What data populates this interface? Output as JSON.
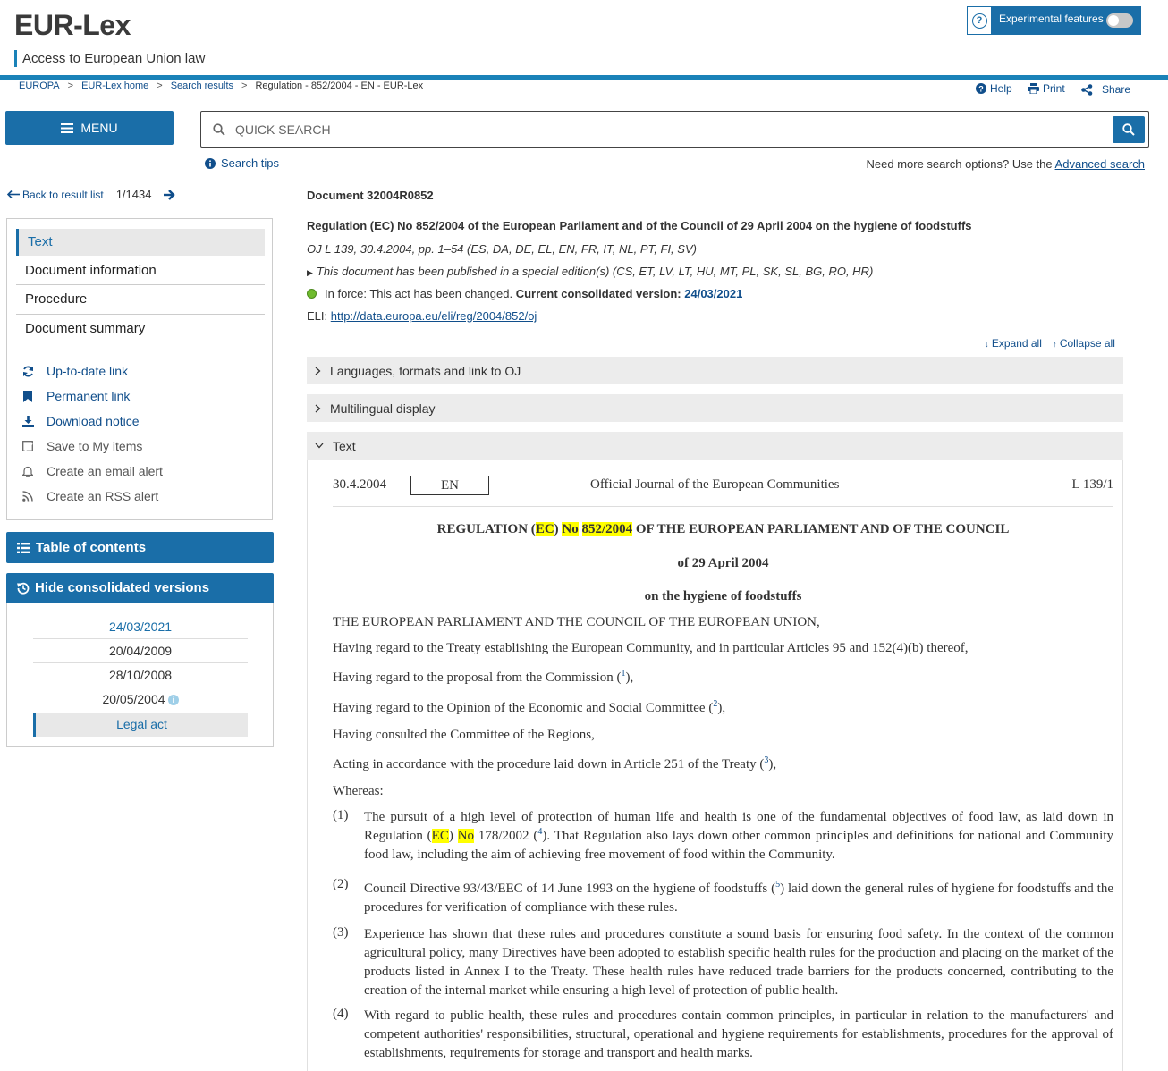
{
  "header": {
    "logo": "EUR-Lex",
    "tagline": "Access to European Union law",
    "experimental_label": "Experimental features"
  },
  "breadcrumb": [
    "EUROPA",
    "EUR-Lex home",
    "Search results",
    "Regulation - 852/2004 - EN - EUR-Lex"
  ],
  "tools": {
    "help": "Help",
    "print": "Print",
    "share": "Share"
  },
  "menu_label": "MENU",
  "search": {
    "placeholder": "QUICK SEARCH",
    "tips": "Search tips",
    "more_text": "Need more search options? Use the",
    "advanced": "Advanced search"
  },
  "nav": {
    "back": "Back to result list",
    "counter": "1/1434",
    "items": [
      "Text",
      "Document information",
      "Procedure",
      "Document summary"
    ],
    "links": [
      "Up-to-date link",
      "Permanent link",
      "Download notice",
      "Save to My items",
      "Create an email alert",
      "Create an RSS alert"
    ],
    "toc": "Table of contents",
    "hide_versions": "Hide consolidated versions",
    "versions": [
      "24/03/2021",
      "20/04/2009",
      "28/10/2008",
      "20/05/2004"
    ],
    "legal_act": "Legal act"
  },
  "document": {
    "id": "Document 32004R0852",
    "title": "Regulation (EC) No 852/2004 of the European Parliament and of the Council of 29 April 2004 on the hygiene of foodstuffs",
    "oj": "OJ L 139, 30.4.2004, pp. 1–54 (ES, DA, DE, EL, EN, FR, IT, NL, PT, FI, SV)",
    "special": "This document has been published in a special edition(s) (CS, ET, LV, LT, HU, MT, PL, SK, SL, BG, RO, HR)",
    "inforce_text": "In force: This act has been changed.",
    "consolidated_label": "Current consolidated version:",
    "consolidated_date": "24/03/2021",
    "eli_label": "ELI:",
    "eli_url": "http://data.europa.eu/eli/reg/2004/852/oj",
    "expand_all": "Expand all",
    "collapse_all": "Collapse all",
    "sections": [
      "Languages, formats and link to OJ",
      "Multilingual display",
      "Text"
    ]
  },
  "text": {
    "oj_date": "30.4.2004",
    "lang": "EN",
    "oj_name": "Official Journal of the European Communities",
    "oj_ref": "L 139/1",
    "heading_pre": "REGULATION (",
    "heading_ec": "EC",
    "heading_mid": ") ",
    "heading_no": "No",
    "heading_sp": " ",
    "heading_num": "852/2004",
    "heading_post": " OF THE EUROPEAN PARLIAMENT AND OF THE COUNCIL",
    "date_line": "of 29 April 2004",
    "subject": "on the hygiene of foodstuffs",
    "p1": "THE EUROPEAN PARLIAMENT AND THE COUNCIL OF THE EUROPEAN UNION,",
    "p2": "Having regard to the Treaty establishing the European Community, and in particular Articles 95 and 152(4)(b) thereof,",
    "p3": "Having regard to the proposal from the Commission",
    "p4": "Having regard to the Opinion of the Economic and Social Committee",
    "p5": "Having consulted the Committee of the Regions,",
    "p6": "Acting in accordance with the procedure laid down in Article 251 of the Treaty",
    "p7": "Whereas:",
    "r1a": "The pursuit of a high level of protection of human life and health is one of the fundamental objectives of food law, as laid down in Regulation (",
    "r1b": " 178/2002 ",
    "r1c": ". That Regulation also lays down other common principles and definitions for national and Community food law, including the aim of achieving free movement of food within the Community.",
    "r2a": "Council Directive 93/43/EEC of 14 June 1993 on the hygiene of foodstuffs ",
    "r2b": " laid down the general rules of hygiene for foodstuffs and the procedures for verification of compliance with these rules.",
    "r3": "Experience has shown that these rules and procedures constitute a sound basis for ensuring food safety. In the context of the common agricultural policy, many Directives have been adopted to establish specific health rules for the production and placing on the market of the products listed in Annex I to the Treaty. These health rules have reduced trade barriers for the products concerned, contributing to the creation of the internal market while ensuring a high level of protection of public health.",
    "r4": "With regard to public health, these rules and procedures contain common principles, in particular in relation to the manufacturers' and competent authorities' responsibilities, structural, operational and hygiene requirements for establishments, procedures for the approval of establishments, requirements for storage and transport and health marks.",
    "fn": [
      "1",
      "2",
      "3",
      "4",
      "5"
    ],
    "rec_nums": [
      "(1)",
      "(2)",
      "(3)",
      "(4)"
    ],
    "ec": "EC",
    "no": "No"
  }
}
